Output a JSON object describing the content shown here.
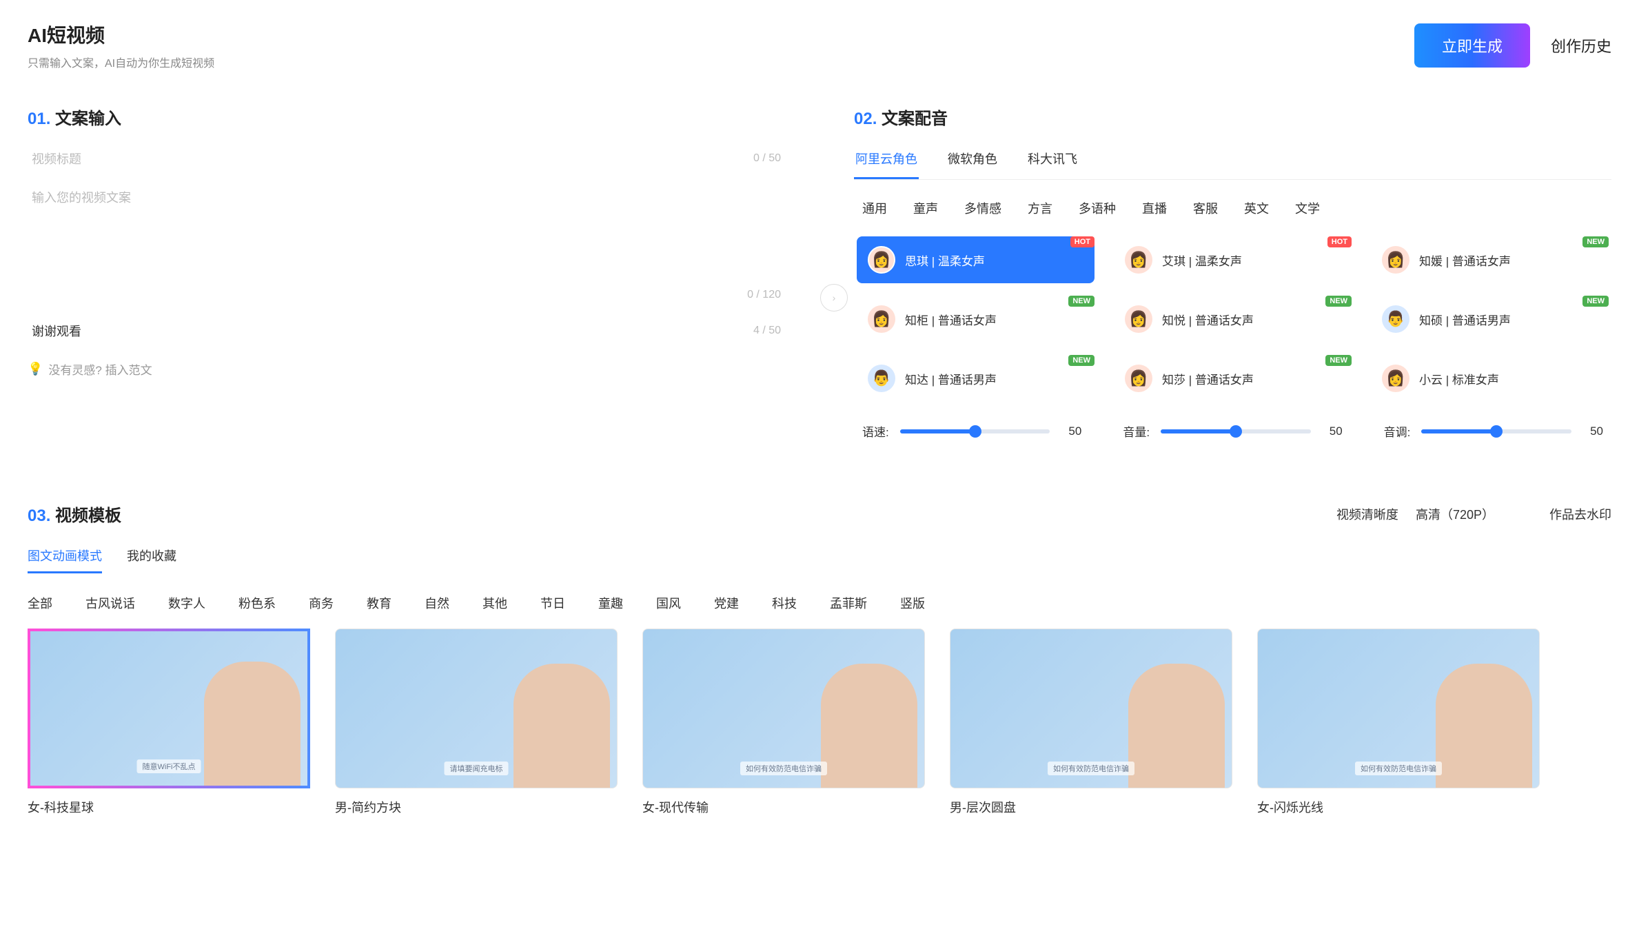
{
  "header": {
    "title": "AI短视频",
    "subtitle": "只需输入文案，AI自动为你生成短视频",
    "generate_btn": "立即生成",
    "history_link": "创作历史"
  },
  "section1": {
    "num": "01.",
    "title": "文案输入",
    "title_placeholder": "视频标题",
    "title_counter": "0 / 50",
    "content_placeholder": "输入您的视频文案",
    "content_counter": "0 / 120",
    "ending_value": "谢谢观看",
    "ending_counter": "4 / 50",
    "hint_text": "没有灵感? 插入范文"
  },
  "section2": {
    "num": "02.",
    "title": "文案配音",
    "providers": [
      "阿里云角色",
      "微软角色",
      "科大讯飞"
    ],
    "categories": [
      "通用",
      "童声",
      "多情感",
      "方言",
      "多语种",
      "直播",
      "客服",
      "英文",
      "文学"
    ],
    "voices": [
      {
        "label": "思琪 | 温柔女声",
        "badge": "HOT",
        "gender": "f",
        "selected": true
      },
      {
        "label": "艾琪 | 温柔女声",
        "badge": "HOT",
        "gender": "f"
      },
      {
        "label": "知媛 | 普通话女声",
        "badge": "NEW",
        "gender": "f"
      },
      {
        "label": "知柜 | 普通话女声",
        "badge": "NEW",
        "gender": "f"
      },
      {
        "label": "知悦 | 普通话女声",
        "badge": "NEW",
        "gender": "f"
      },
      {
        "label": "知硕 | 普通话男声",
        "badge": "NEW",
        "gender": "m"
      },
      {
        "label": "知达 | 普通话男声",
        "badge": "NEW",
        "gender": "m"
      },
      {
        "label": "知莎 | 普通话女声",
        "badge": "NEW",
        "gender": "f"
      },
      {
        "label": "小云 | 标准女声",
        "badge": "",
        "gender": "f"
      }
    ],
    "sliders": [
      {
        "label": "语速:",
        "value": "50"
      },
      {
        "label": "音量:",
        "value": "50"
      },
      {
        "label": "音调:",
        "value": "50"
      }
    ]
  },
  "section3": {
    "num": "03.",
    "title": "视频模板",
    "clarity_label": "视频清晰度",
    "clarity_value": "高清（720P）",
    "watermark": "作品去水印",
    "modes": [
      "图文动画模式",
      "我的收藏"
    ],
    "categories": [
      "全部",
      "古风说话",
      "数字人",
      "粉色系",
      "商务",
      "教育",
      "自然",
      "其他",
      "节日",
      "童趣",
      "国风",
      "党建",
      "科技",
      "孟菲斯",
      "竖版"
    ],
    "templates": [
      {
        "name": "女-科技星球",
        "gender": "f",
        "selected": true,
        "caption": "随意WiFi不乱点"
      },
      {
        "name": "男-简约方块",
        "gender": "m",
        "caption": "请填要闻充电标"
      },
      {
        "name": "女-现代传输",
        "gender": "f",
        "caption": "如何有效防范电信诈骗"
      },
      {
        "name": "男-层次圆盘",
        "gender": "m",
        "caption": "如何有效防范电信诈骗"
      },
      {
        "name": "女-闪烁光线",
        "gender": "f",
        "caption": "如何有效防范电信诈骗"
      }
    ]
  }
}
